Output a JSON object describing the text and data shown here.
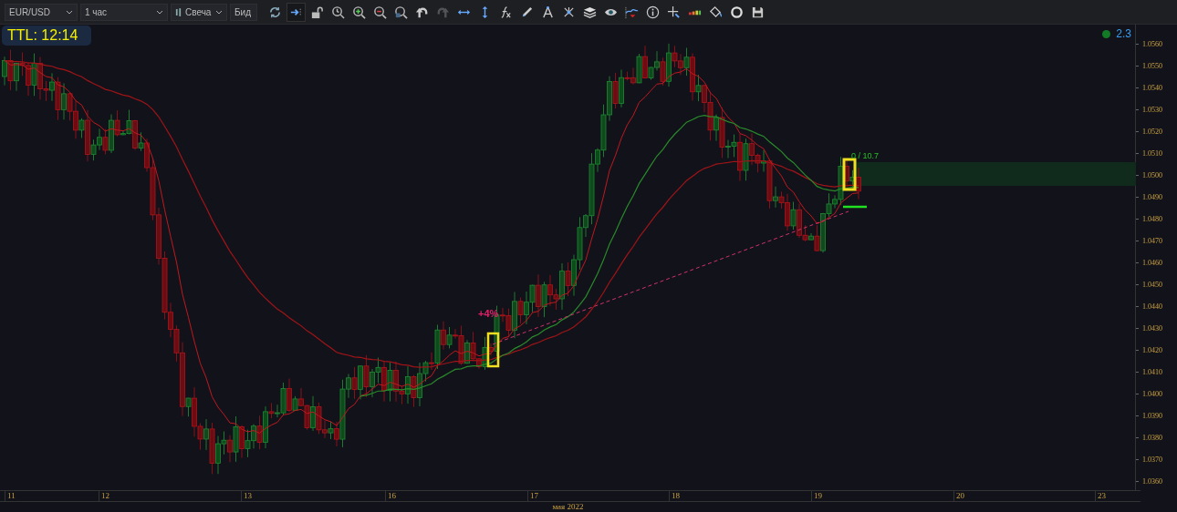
{
  "toolbar": {
    "symbol": "EUR/USD",
    "timeframe": "1 час",
    "chart_type": "Свеча",
    "price_side": "Бид",
    "autoscroll": {
      "on": true
    },
    "redo": {
      "disabled": true
    }
  },
  "ttl": "TTL: 12:14",
  "indicator": "2.3",
  "chart": {
    "annotations": [
      {
        "kind": "percent",
        "text": "+4%"
      },
      {
        "kind": "ratio",
        "text": "0 / 10.7"
      }
    ],
    "price_axis": [
      "1.0560",
      "1.0550",
      "1.0540",
      "1.0530",
      "1.0520",
      "1.0510",
      "1.0500",
      "1.0490",
      "1.0480",
      "1.0470",
      "1.0460",
      "1.0450",
      "1.0440",
      "1.0430",
      "1.0420",
      "1.0410",
      "1.0400",
      "1.0390",
      "1.0380",
      "1.0370",
      "1.0360"
    ],
    "time_axis": [
      "11",
      "12",
      "13",
      "16",
      "17",
      "18",
      "19",
      "20",
      "23"
    ],
    "month_label": "мая 2022"
  }
}
